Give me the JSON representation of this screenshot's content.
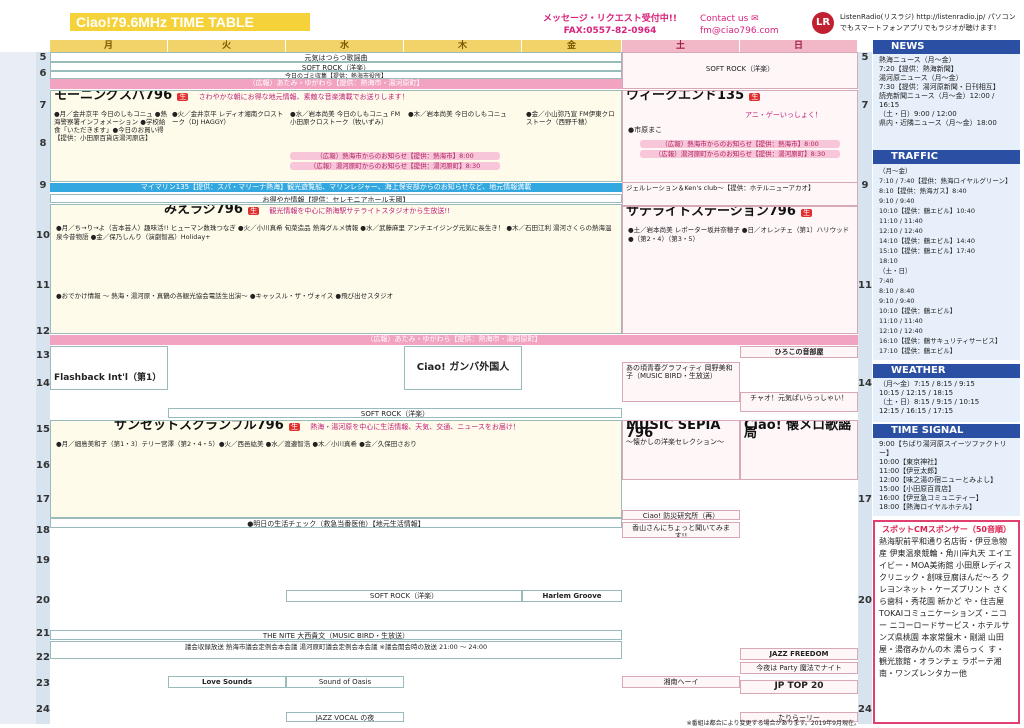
{
  "header": {
    "title": "Ciao!79.6MHz TIME TABLE",
    "message": "メッセージ・リクエスト受付中!! FAX:0557-82-0964",
    "contact": "Contact us ✉fm@ciao796.com",
    "logo": "LR",
    "listenradio": "ListenRadio(リスラジ) http://listenradio.jp/ パソコンでもスマートフォンアプリでもラジオが聴けます!"
  },
  "days": [
    "月",
    "火",
    "水",
    "木",
    "金",
    "土",
    "日"
  ],
  "hours": [
    "5",
    "6",
    "7",
    "8",
    "9",
    "10",
    "11",
    "12",
    "13",
    "14",
    "15",
    "16",
    "17",
    "18",
    "19",
    "20",
    "21",
    "22",
    "23",
    "24"
  ],
  "grid": {
    "weekday_top": "元気はつらつ歌謡曲",
    "soft_rock": "SOFT ROCK（洋楽）",
    "kyou": "今日のゴミ収集【提供：熱海市役所】",
    "ad_band": "（広報）あたみ・ゆがわら【提供：熱海市・湯河原町】",
    "morning_title": "モーニングスパ796",
    "morning_desc": "さわやかな朝にお得な地元情報、素敵な音楽満載でお送りします！",
    "morning_items": "●月／金井京平 今日のしもコニュ ●熱海警察署インフォメーション ●学校給食「いただきます」●今日のお買い得【提供：小田原百貨店湯河原店】",
    "morning_tue": "●火／金井京平 レディオ湘南クロストーク（DJ HAGGY）",
    "morning_wed": "●水／岩本尚美 今日のしもコニュ FM小田原クロストーク（牧いずみ）",
    "morning_thu": "●木／岩本尚美 今日のしもコニュ",
    "morning_fri": "●金／小山弥乃宣 FM伊東クロストーク（西野千穂）",
    "atami_news": "（広報）熱海市からのお知らせ【提供：熱海市】8:00",
    "yugawara_news": "（広報）湯河原町からのお知らせ【提供：湯河原町】8:30",
    "mymarine": "マイマリン135【提供：スパ・マリーナ熱海】観光遊覧船、マリンレジャー、海上保安部からのお知らせなど、地元情報満載",
    "weekend_title": "ウィークエンド135",
    "weekend_host": "●市原まこ",
    "weekend_sub": "アニ・ゲーいっしょく！",
    "okaimono": "お得やか情報【提供：セレモニアホール天國】",
    "mie_title": "みえラジ796",
    "mie_desc": "観光情報を中心に熱海駅サテライトスタジオから生放送!!",
    "mie_items": "●月／ち→り→よ（吉本芸人）趣味活!! ヒューマン数珠つなぎ ●火／小川真希 旬菜造品 熱海グルメ情報 ●水／武藤麻里 アンチエイジング元気に長生き！ ●木／石田江利 湯河さくらの熱海温泉今昔物語 ●金／保乃しんり（演劇智高）Holiday+",
    "mie_bottom": "●おでかけ情報 〜 熱海・湯河原・真鶴の各観光協会電話生出演〜 ●キャッスル・ザ・ヴォイス ●飛び出せスタジオ",
    "satellite_title": "サテライトステーション796",
    "satellite_items": "●土／岩本尚美 レポーター坂井奈穂子 ●日／オレンチェ（第1）ハリウッド ●（第2・4）（第3・5）",
    "jellation": "ジェルレーション＆Ken's club〜【提供：ホテルニューアカオ】",
    "sunset_title": "サンセットスクランブル796",
    "sunset_desc": "熱海・湯河原を中心に生活情報、天気、交通、ニュースをお届け！",
    "sunset_items": "●月／細島美和子（第1・3）テリー宮澤（第2・4・5）●火／西邑紘美 ●水／渡邉智浩 ●木／小川真希 ●金／久保田さおり",
    "flashback": "Flashback Int'l（第1）",
    "ciao_gaijin": "Ciao! ガンバ外国人",
    "music_sepia": "MUSIC SEPIA 796",
    "music_sepia_sub": "〜懐かしの洋楽セレクション〜",
    "ciao_kayou": "Ciao! 懐メロ歌謡局",
    "hiroko": "ひろこの音部屋",
    "graffiti": "あの頃青春グラフィティ 岡野美和子（MUSIC BIRD・生放送）",
    "chao_genki": "チャオ！元気ぱいらっしゃい！",
    "ashita": "●明日の生活チェック（救急当番医他）【地元生活情報】",
    "kahadan": "Ciao! 防災研究所（再）",
    "ochanoma": "香山さんにちょっと聞いてみます!!",
    "jazz_vocal": "JAZZ VOCAL の夜",
    "nite": "THE NITE 大西貴文（MUSIC BIRD・生放送）",
    "gikai": "議会収録放送 熱海市議会定例会本会議 湯河原町議会定例会本会議 ※議会開会時の放送 21:00 〜 24:00",
    "harlem": "Harlem Groove",
    "love_sounds": "Love Sounds",
    "sound_oasis": "Sound of Oasis",
    "jp_top20": "JP TOP 20",
    "jazz_freedom": "JAZZ FREEDOM",
    "party": "今夜は Party 魔法でナイト",
    "shonan": "湘南ヘーイ",
    "tarirori": "たりらーリー",
    "hikari": "Ciao!"
  },
  "side": {
    "news": {
      "title": "NEWS",
      "items": [
        "熱海ニュース（月〜金）",
        "7:20【提供：熱海新聞】",
        "湯河原ニュース（月〜金）",
        "7:30【提供：湯河原新聞・日刊相互】",
        "読売新聞ニュース（月〜金）12:00 / 16:15",
        "（土・日）9:00 / 12:00",
        "県内・近隣ニュース（月〜金）18:00"
      ]
    },
    "traffic": {
      "title": "TRAFFIC",
      "items": [
        "（月〜金）",
        "7:10 / 7:40【提供：熱海ロイヤルグリーン】",
        "8:10【提供：熱海ガス】8:40",
        "9:10 / 9:40",
        "10:10【提供：鶴エビル】10:40",
        "11:10 / 11:40",
        "12:10 / 12:40",
        "14:10【提供：鶴エビル】14:40",
        "15:10【提供：鶴エビル】17:40",
        "18:10",
        "（土・日）",
        "7:40",
        "8:10 / 8:40",
        "9:10 / 9:40",
        "10:10【提供：鶴エビル】",
        "11:10 / 11:40",
        "12:10 / 12:40",
        "16:10【提供：鶴サキュリティサービス】",
        "17:10【提供：鶴エビル】"
      ]
    },
    "weather": {
      "title": "WEATHER",
      "items": [
        "（月〜金）7:15 / 8:15 / 9:15",
        "10:15 / 12:15 / 18:15",
        "（土・日）8:15 / 9:15 / 10:15",
        "12:15 / 16:15 / 17:15"
      ]
    },
    "timesignal": {
      "title": "TIME SIGNAL",
      "items": [
        "9:00【ちばり湯河原スイーツファクトリー】",
        "10:00【東京神社】",
        "11:00【伊豆太郎】",
        "12:00【味之湯の宿ニューとみよし】",
        "15:00【小田原百貨店】",
        "16:00【伊豆急コミュニティー】",
        "18:00【熱海ロイヤルホテル】"
      ]
    },
    "sponsor": {
      "title": "スポットCMスポンサー（50音順）",
      "body": "熱海駅前平和通り名店街・伊豆急物産 伊東温泉競輪・角川岸丸天 エイエイビー・MOA美術館 小田原レディスクリニック・創味豆腐ほんだ〜ろ クレヨンネット・ケーズプリント さくら歯科・秀花園 新かど や・住吉屋 TOKAIコミュニケーションズ・ニコー ニコーロードサービス・ホテルサンズ県桃園 本家常盤木・剛湖 山田屋・湯宿みかんの木 湯らっく す・ 観光旅館・オランチェ ラポーテ湘南・ワンズレンタカー他"
    }
  },
  "footnote": "※番組は都合により変更する場合があります。2019年9月現在。"
}
